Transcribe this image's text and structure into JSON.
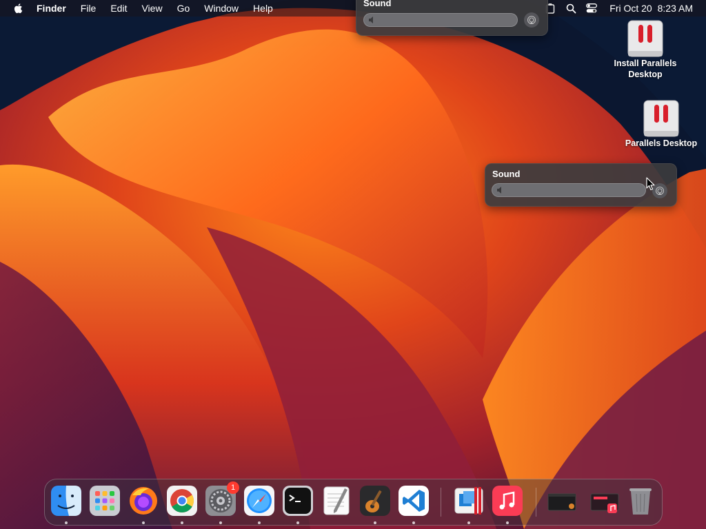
{
  "menubar": {
    "app_name": "Finder",
    "menus": [
      "File",
      "Edit",
      "View",
      "Go",
      "Window",
      "Help"
    ],
    "status_icons": [
      "clipboard-icon",
      "search-icon",
      "control-center-icon"
    ],
    "clock_date": "Fri Oct 20",
    "clock_time": "8:23 AM"
  },
  "sound_panels": [
    {
      "title": "Sound",
      "volume": 0.0,
      "icons": [
        "speaker-icon",
        "airplay-icon"
      ]
    },
    {
      "title": "Sound",
      "volume": 0.0,
      "icons": [
        "speaker-icon",
        "airplay-icon"
      ]
    }
  ],
  "desktop_icons": [
    {
      "label": "Install Parallels Desktop",
      "icon": "parallels-drive-icon"
    },
    {
      "label": "Parallels Desktop",
      "icon": "parallels-drive-icon"
    }
  ],
  "dock": {
    "apps": [
      {
        "name": "Finder",
        "icon": "finder-icon",
        "running": true
      },
      {
        "name": "Launchpad",
        "icon": "launchpad-icon",
        "running": false
      },
      {
        "name": "Firefox",
        "icon": "firefox-icon",
        "running": true
      },
      {
        "name": "Google Chrome",
        "icon": "chrome-icon",
        "running": true
      },
      {
        "name": "System Settings",
        "icon": "system-settings-icon",
        "running": true,
        "badge": "1"
      },
      {
        "name": "Safari",
        "icon": "safari-icon",
        "running": true
      },
      {
        "name": "Terminal",
        "icon": "terminal-icon",
        "running": true
      },
      {
        "name": "TextEdit",
        "icon": "textedit-icon",
        "running": false
      },
      {
        "name": "GarageBand",
        "icon": "garageband-icon",
        "running": true
      },
      {
        "name": "Visual Studio Code",
        "icon": "vscode-icon",
        "running": true
      },
      {
        "name": "Parallels Desktop",
        "icon": "parallels-icon",
        "running": true
      },
      {
        "name": "Music",
        "icon": "music-icon",
        "running": true
      },
      {
        "name": "Recent Window 1",
        "icon": "minimized-window-icon",
        "running": false
      },
      {
        "name": "Recent Window 2",
        "icon": "minimized-music-window-icon",
        "running": false
      },
      {
        "name": "Trash",
        "icon": "trash-icon",
        "running": false
      }
    ]
  },
  "colors": {
    "menubar_bg": "#19141980",
    "panel_bg": "#3c3c3e",
    "badge": "#ff3b30",
    "parallels_red": "#d81e2a"
  }
}
